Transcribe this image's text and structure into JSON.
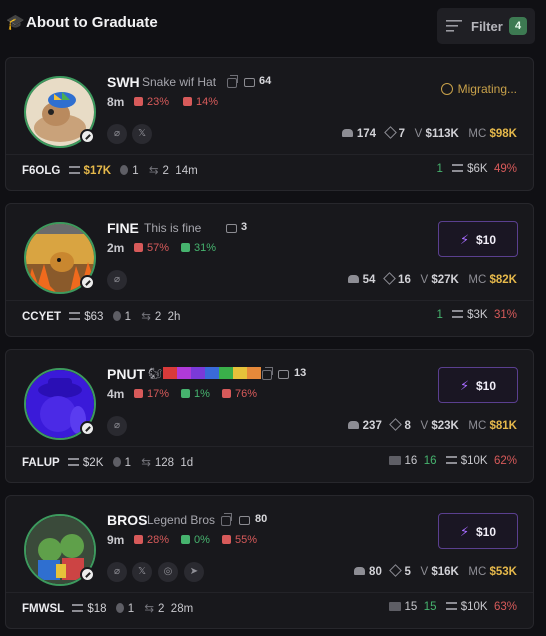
{
  "header": {
    "title": "About to Graduate",
    "filter_label": "Filter",
    "filter_count": "4"
  },
  "colors": {
    "accent_green": "#46b36e",
    "accent_red": "#d75a5a",
    "mc_gold": "#e6b94b",
    "buy_purple": "#a66bff",
    "migrating_gold": "#c8a14a"
  },
  "cards": [
    {
      "ticker": "SWH",
      "name": "Snake wif Hat",
      "comments": "64",
      "age": "8m",
      "stat1": "23%",
      "stat2": "14%",
      "holders": "174",
      "hits": "7",
      "volume": "$113K",
      "mc": "$98K",
      "status": "Migrating...",
      "footer_ticker": "F6OLG",
      "liquidity": "$17K",
      "coin_count": "1",
      "tx_count": "2",
      "tx_age": "14m",
      "buys": "1",
      "buy_amount": "$6K",
      "sell_pct": "49%",
      "socials": [
        "link-icon",
        "x-icon"
      ]
    },
    {
      "ticker": "FINE",
      "name": "This is fine",
      "comments": "3",
      "age": "2m",
      "stat1": "57%",
      "stat2": "31%",
      "holders": "54",
      "hits": "16",
      "volume": "$27K",
      "mc": "$82K",
      "buy_label": "$10",
      "footer_ticker": "CCYET",
      "liquidity": "$63",
      "coin_count": "1",
      "tx_count": "2",
      "tx_age": "2h",
      "buys": "1",
      "buy_amount": "$3K",
      "sell_pct": "31%",
      "socials": [
        "link-icon"
      ]
    },
    {
      "ticker": "PNUT",
      "comments": "13",
      "age": "4m",
      "stat1": "17%",
      "stat2": "1%",
      "stat3": "76%",
      "holders": "237",
      "hits": "8",
      "volume": "$23K",
      "mc": "$81K",
      "buy_label": "$10",
      "footer_ticker": "FALUP",
      "liquidity": "$2K",
      "coin_count": "1",
      "tx_count": "128",
      "tx_age": "1d",
      "folder_count": "16",
      "buys": "16",
      "buy_amount": "$10K",
      "sell_pct": "62%",
      "socials": [
        "link-icon"
      ]
    },
    {
      "ticker": "BROS",
      "name": "Legend Bros",
      "comments": "80",
      "age": "9m",
      "stat1": "28%",
      "stat2": "0%",
      "stat3": "55%",
      "holders": "80",
      "hits": "5",
      "volume": "$16K",
      "mc": "$53K",
      "buy_label": "$10",
      "footer_ticker": "FMWSL",
      "liquidity": "$18",
      "coin_count": "1",
      "tx_count": "2",
      "tx_age": "28m",
      "folder_count": "15",
      "buys": "15",
      "buy_amount": "$10K",
      "sell_pct": "63%",
      "socials": [
        "link-icon",
        "x-icon",
        "globe-icon",
        "telegram-icon"
      ]
    }
  ]
}
